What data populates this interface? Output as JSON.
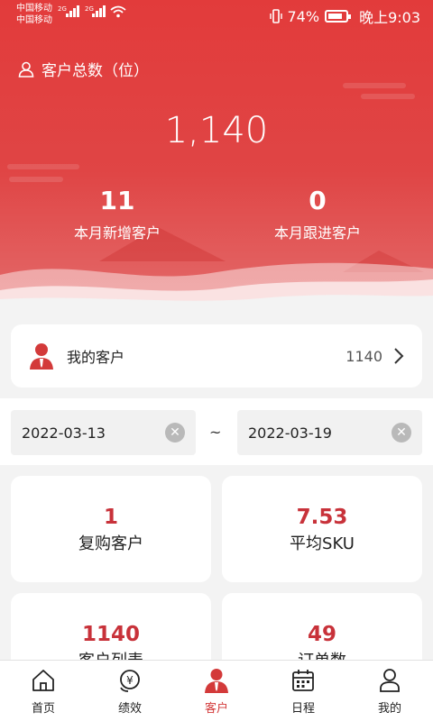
{
  "status": {
    "carrier1": "中国移动",
    "carrier2": "中国移动",
    "net1": "2G",
    "net2": "2G",
    "battery": "74%",
    "time": "晚上9:03"
  },
  "header": {
    "title": "客户总数（位）",
    "total": "1,140",
    "new_count": "11",
    "new_label": "本月新增客户",
    "follow_count": "0",
    "follow_label": "本月跟进客户"
  },
  "my_customers": {
    "label": "我的客户",
    "count": "1140"
  },
  "date_range": {
    "start": "2022-03-13",
    "separator": "~",
    "end": "2022-03-19"
  },
  "metrics": [
    {
      "value": "1",
      "label": "复购客户"
    },
    {
      "value": "7.53",
      "label": "平均SKU"
    },
    {
      "value": "1140",
      "label": "客户列表"
    },
    {
      "value": "49",
      "label": "订单数"
    }
  ],
  "tabs": [
    {
      "label": "首页",
      "icon": "home-icon"
    },
    {
      "label": "绩效",
      "icon": "performance-icon"
    },
    {
      "label": "客户",
      "icon": "customer-icon"
    },
    {
      "label": "日程",
      "icon": "calendar-icon"
    },
    {
      "label": "我的",
      "icon": "profile-icon"
    }
  ],
  "colors": {
    "primary_red": "#e23b3b",
    "metric_red": "#c8323a"
  }
}
